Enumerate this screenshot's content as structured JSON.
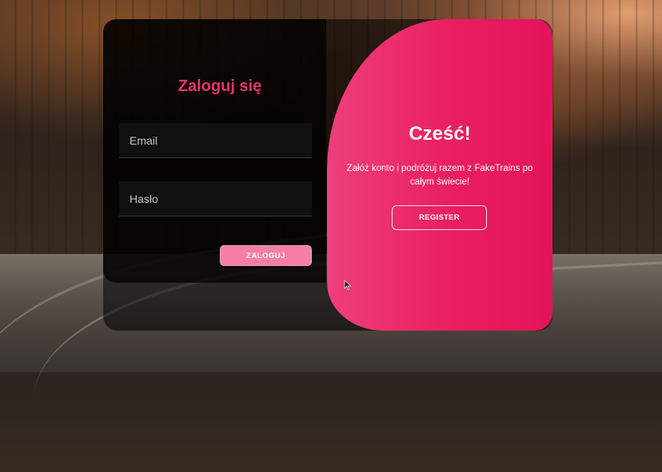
{
  "login": {
    "title": "Zaloguj się",
    "email_placeholder": "Email",
    "password_placeholder": "Hasło",
    "submit_label": "ZALOGUJ"
  },
  "welcome": {
    "title": "Cześć!",
    "message": "Załóż konto i podróżuj razem z FakeTrains po całym świecie!",
    "register_label": "REGISTER"
  },
  "colors": {
    "accent": "#e8346a",
    "button_pink": "#f47fa3",
    "overlay_start": "#ee3f7c",
    "overlay_end": "#e4135a"
  },
  "icons": {
    "cursor": "mouse-pointer-icon"
  }
}
